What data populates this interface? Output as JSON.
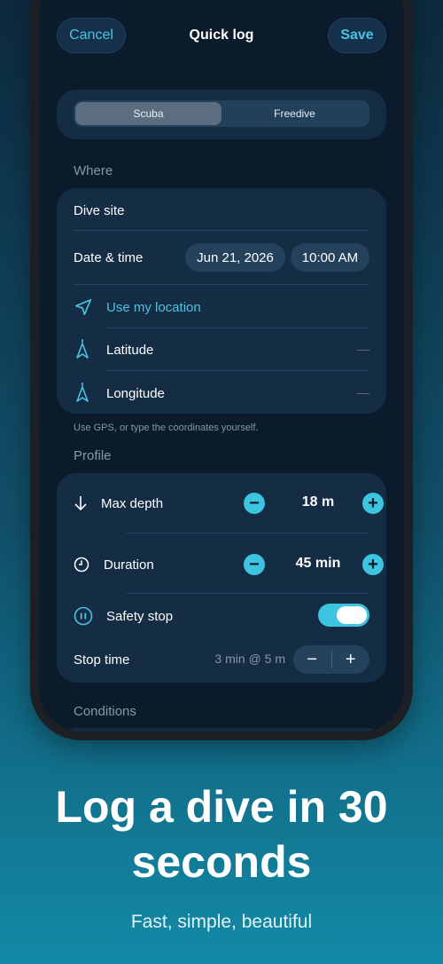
{
  "nav": {
    "cancel": "Cancel",
    "title": "Quick log",
    "save": "Save"
  },
  "mode": {
    "options": [
      "Scuba",
      "Freedive"
    ],
    "selected": "Scuba"
  },
  "where": {
    "section": "Where",
    "dive_site_placeholder": "Dive site",
    "date_time_label": "Date & time",
    "date": "Jun 21, 2026",
    "time": "10:00 AM",
    "use_location": "Use my location",
    "latitude_label": "Latitude",
    "latitude_value": "—",
    "longitude_label": "Longitude",
    "longitude_value": "—",
    "hint": "Use GPS, or type the coordinates yourself."
  },
  "profile": {
    "section": "Profile",
    "max_depth_label": "Max depth",
    "max_depth_value": "18 m",
    "duration_label": "Duration",
    "duration_value": "45 min",
    "safety_stop_label": "Safety stop",
    "safety_stop_on": true,
    "stop_time_label": "Stop time",
    "stop_time_value": "3 min @ 5 m",
    "minus": "−",
    "plus": "+"
  },
  "conditions": {
    "section": "Conditions"
  },
  "promo": {
    "headline": "Log a dive in 30 seconds",
    "subtitle": "Fast, simple, beautiful"
  },
  "colors": {
    "accent": "#3cc4e0",
    "card": "#142c44",
    "screen": "#0c1b2b"
  }
}
